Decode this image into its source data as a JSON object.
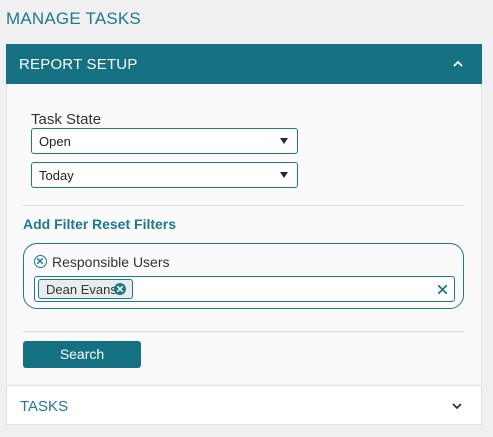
{
  "page": {
    "title": "MANAGE TASKS"
  },
  "report_setup": {
    "title": "REPORT SETUP",
    "expanded": true,
    "task_state_label": "Task State",
    "state_select_value": "Open",
    "date_select_value": "Today",
    "add_filter_label": "Add Filter",
    "reset_filters_label": "Reset Filters",
    "filter": {
      "title": "Responsible Users",
      "selected": [
        "Dean Evans"
      ]
    },
    "search_label": "Search"
  },
  "tasks": {
    "title": "TASKS",
    "expanded": false
  },
  "colors": {
    "accent": "#137181",
    "link": "#1b7a8c",
    "background": "#f0f0f0"
  },
  "icons": {
    "collapse": "chevron-up-icon",
    "expand": "chevron-down-icon",
    "dropdown": "caret-down-icon",
    "remove": "close-circle-icon",
    "clear": "close-icon"
  }
}
